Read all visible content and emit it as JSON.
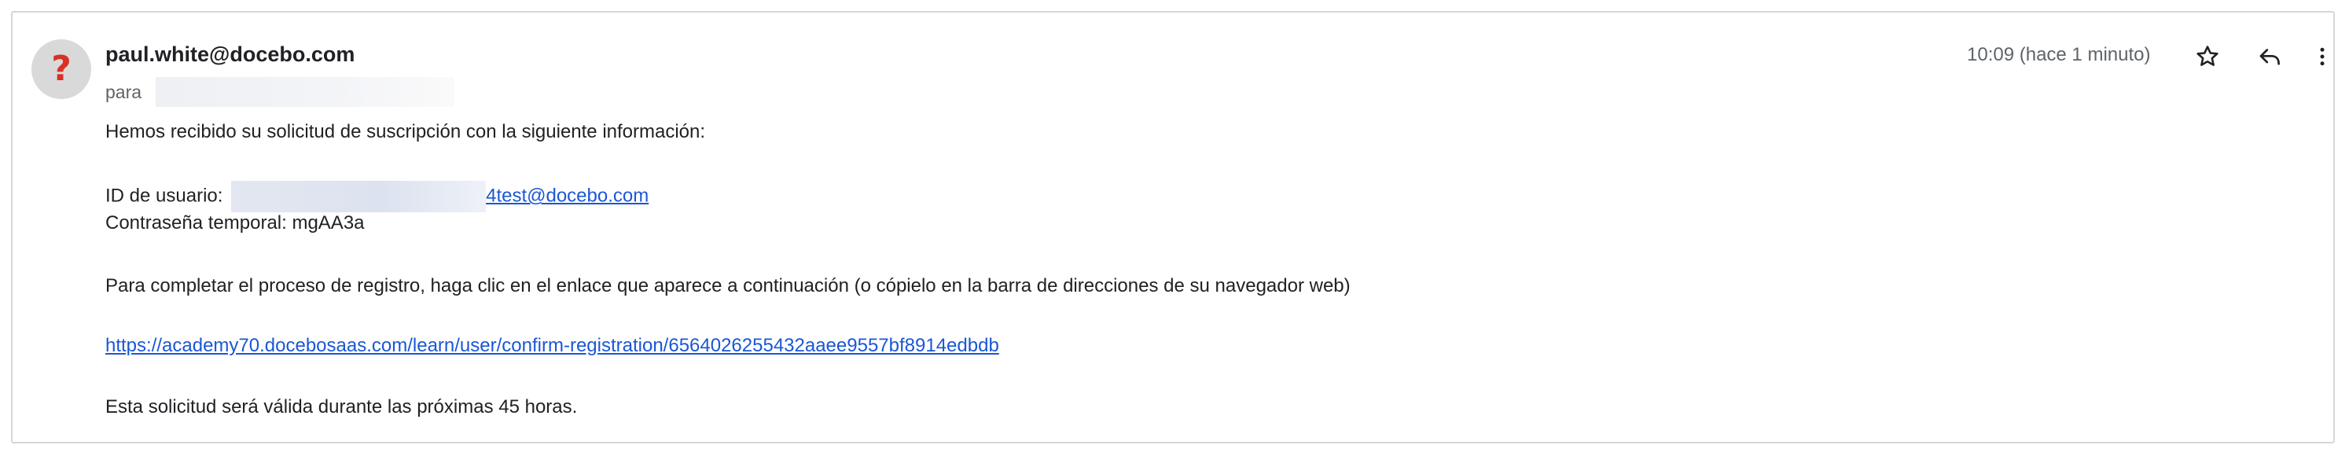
{
  "email": {
    "sender": "paul.white@docebo.com",
    "to_label": "para",
    "time": "10:09 (hace 1 minuto)",
    "avatar_glyph": "?",
    "body": {
      "intro": "Hemos recibido su solicitud de suscripción con la siguiente información:",
      "user_id_label": "ID de usuario:",
      "user_id_link": "4test@docebo.com",
      "temp_password": "Contraseña temporal: mgAA3a",
      "instructions": "Para completar el proceso de registro, haga clic en el enlace que aparece a continuación (o cópielo en la barra de direcciones de su navegador web)",
      "confirm_link": "https://academy70.docebosaas.com/learn/user/confirm-registration/6564026255432aaee9557bf8914edbdb",
      "validity": "Esta solicitud será válida durante las próximas 45 horas."
    }
  },
  "icons": {
    "star": "star-icon",
    "reply": "reply-icon",
    "more": "more-vert-icon"
  },
  "colors": {
    "link": "#1a57d6",
    "avatar_bg": "#d9d9d9",
    "avatar_glyph": "#d93025"
  }
}
